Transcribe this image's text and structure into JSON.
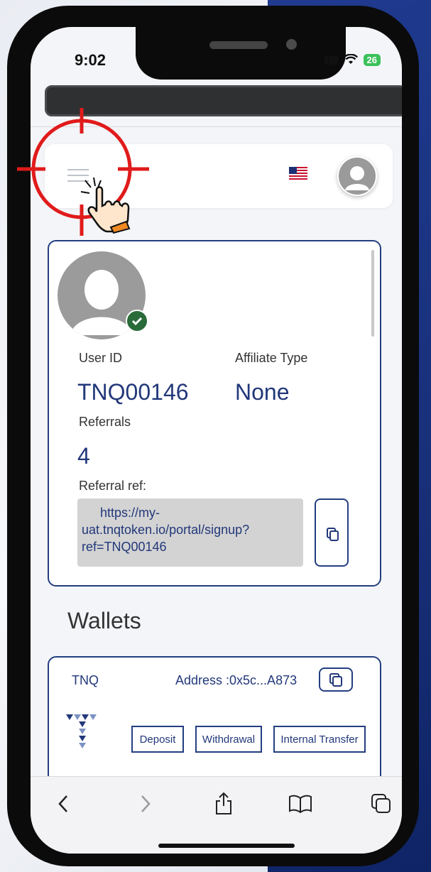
{
  "status_bar": {
    "time": "9:02",
    "battery": "26"
  },
  "profile": {
    "user_id_label": "User ID",
    "user_id_value": "TNQ00146",
    "affiliate_type_label": "Affiliate Type",
    "affiliate_type_value": "None",
    "referrals_label": "Referrals",
    "referrals_value": "4",
    "referral_ref_label": "Referral ref:",
    "referral_ref_line1": "https://my-",
    "referral_ref_line2": "uat.tnqtoken.io/portal/signup?",
    "referral_ref_line3": "ref=TNQ00146"
  },
  "wallets": {
    "title": "Wallets",
    "items": [
      {
        "token": "TNQ",
        "address": "Address :0x5c...A873",
        "deposit_label": "Deposit",
        "withdrawal_label": "Withdrawal",
        "internal_transfer_label": "Internal Transfer"
      }
    ]
  },
  "icons": {
    "menu": "hamburger-menu-icon",
    "flag": "us-flag-icon",
    "avatar": "user-avatar-icon",
    "copy": "copy-icon",
    "back": "back-icon",
    "forward": "forward-icon",
    "share": "share-icon",
    "bookmarks": "bookmarks-icon",
    "tabs": "tabs-icon"
  },
  "colors": {
    "accent": "#22387a",
    "verified": "#2a6b3a",
    "highlight": "#e01b1b"
  }
}
